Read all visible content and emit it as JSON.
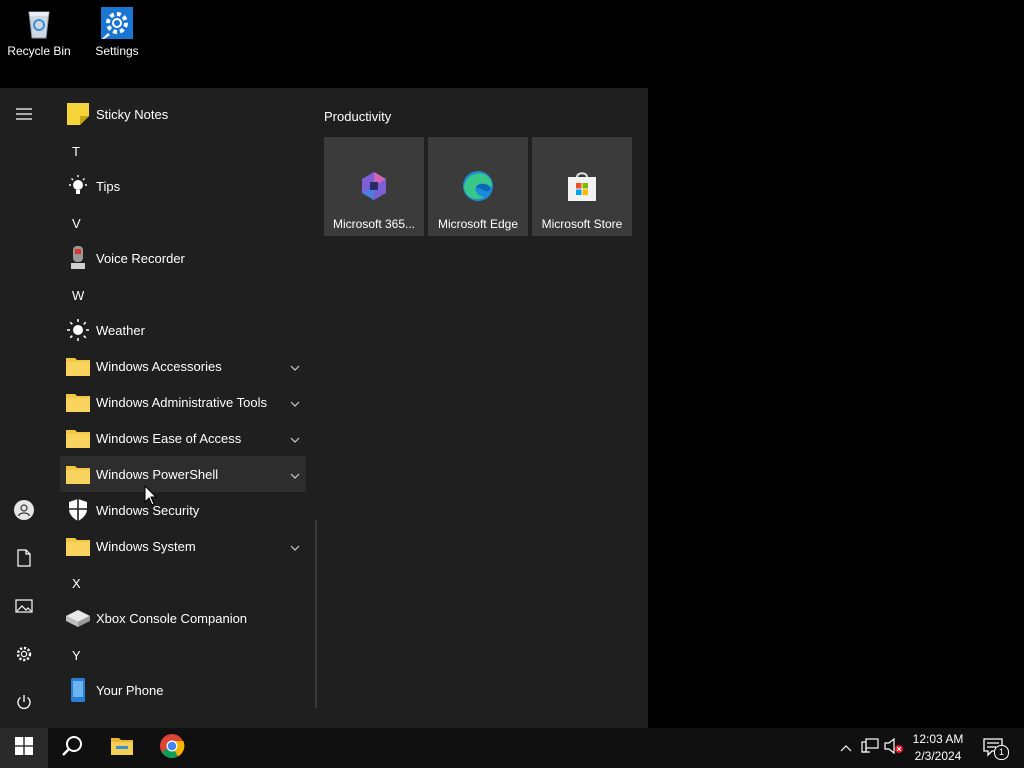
{
  "desktop": {
    "icons": [
      {
        "label": "Recycle Bin",
        "icon": "recycle-bin-icon"
      },
      {
        "label": "Settings",
        "icon": "settings-gear-icon"
      }
    ]
  },
  "start_menu": {
    "rail": [
      {
        "name": "expand-menu",
        "icon": "hamburger-icon"
      },
      {
        "name": "account",
        "icon": "user-icon"
      },
      {
        "name": "documents",
        "icon": "document-icon"
      },
      {
        "name": "pictures",
        "icon": "pictures-icon"
      },
      {
        "name": "settings",
        "icon": "gear-icon"
      },
      {
        "name": "power",
        "icon": "power-icon"
      }
    ],
    "app_list": {
      "letters": {
        "t": "T",
        "v": "V",
        "w": "W",
        "x": "X",
        "y": "Y"
      },
      "apps": {
        "sticky_notes": "Sticky Notes",
        "tips": "Tips",
        "voice_recorder": "Voice Recorder",
        "weather": "Weather",
        "windows_accessories": "Windows Accessories",
        "windows_admin_tools": "Windows Administrative Tools",
        "windows_ease_of_access": "Windows Ease of Access",
        "windows_powershell": "Windows PowerShell",
        "windows_security": "Windows Security",
        "windows_system": "Windows System",
        "xbox_console_companion": "Xbox Console Companion",
        "your_phone": "Your Phone"
      },
      "hovered_item": "Windows PowerShell"
    },
    "tiles": {
      "group_title": "Productivity",
      "items": [
        {
          "label": "Microsoft 365...",
          "icon": "microsoft-365-icon"
        },
        {
          "label": "Microsoft Edge",
          "icon": "edge-icon"
        },
        {
          "label": "Microsoft Store",
          "icon": "store-icon"
        }
      ]
    }
  },
  "taskbar": {
    "pinned": [
      {
        "name": "start",
        "icon": "windows-logo-icon"
      },
      {
        "name": "search",
        "icon": "search-icon"
      },
      {
        "name": "file-explorer",
        "icon": "folder-icon"
      },
      {
        "name": "chrome",
        "icon": "chrome-icon"
      }
    ],
    "tray": {
      "time": "12:03 AM",
      "date": "2/3/2024",
      "notification_count": "1"
    }
  },
  "colors": {
    "start_bg": "#1f1f1f",
    "tile_bg": "#3b3b3b",
    "taskbar_bg": "#101010",
    "folder_yellow": "#f2c744",
    "hover_bg": "#2d2d2d"
  }
}
